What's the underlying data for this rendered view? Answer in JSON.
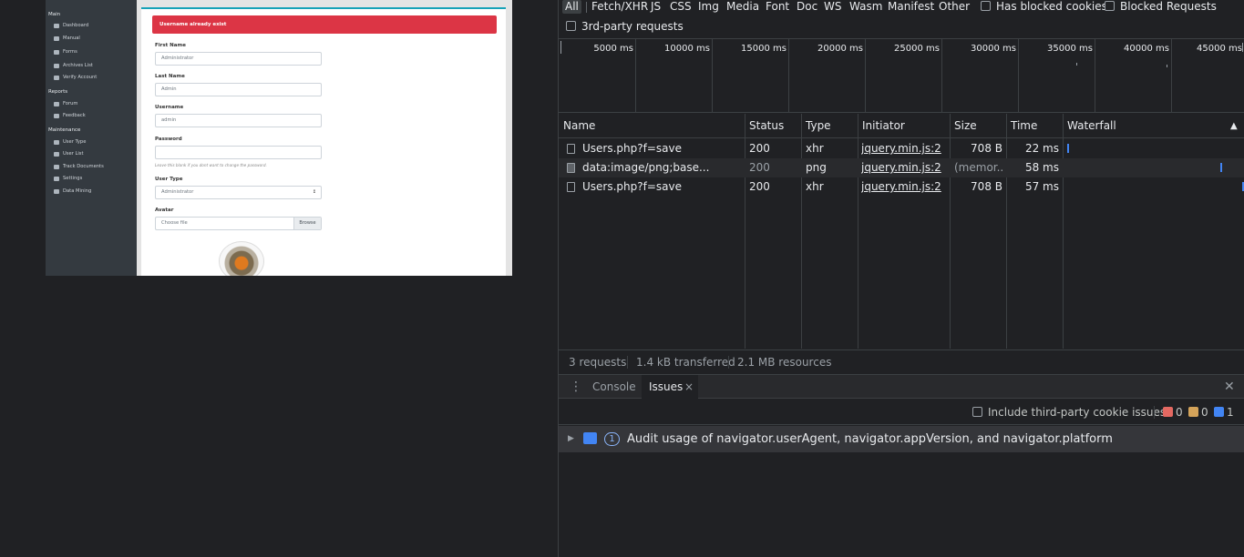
{
  "app": {
    "sidebar": {
      "main_header": "Main",
      "main_items": [
        "Dashboard",
        "Manual",
        "Forms",
        "Archives List",
        "Verify Account"
      ],
      "reports_header": "Reports",
      "reports_items": [
        "Forum",
        "Feedback"
      ],
      "maintenance_header": "Maintenance",
      "maintenance_items": [
        "User Type",
        "User List",
        "Track Documents",
        "Settings",
        "Data Mining"
      ]
    },
    "alert": "Username already exist",
    "form": {
      "first_name_label": "First Name",
      "first_name_value": "Administrator",
      "last_name_label": "Last Name",
      "last_name_value": "Admin",
      "username_label": "Username",
      "username_value": "admin",
      "password_label": "Password",
      "password_value": "",
      "password_hint": "Leave this blank if you dont want to change the password.",
      "user_type_label": "User Type",
      "user_type_value": "Administrator",
      "avatar_label": "Avatar",
      "avatar_placeholder": "Choose file",
      "browse_label": "Browse"
    }
  },
  "devtools": {
    "filters": [
      "All",
      "Fetch/XHR",
      "JS",
      "CSS",
      "Img",
      "Media",
      "Font",
      "Doc",
      "WS",
      "Wasm",
      "Manifest",
      "Other"
    ],
    "has_blocked_cookies": "Has blocked cookies",
    "blocked_requests": "Blocked Requests",
    "third_party": "3rd-party requests",
    "timeline_ticks": [
      "5000 ms",
      "10000 ms",
      "15000 ms",
      "20000 ms",
      "25000 ms",
      "30000 ms",
      "35000 ms",
      "40000 ms",
      "45000 ms"
    ],
    "columns": [
      "Name",
      "Status",
      "Type",
      "Initiator",
      "Size",
      "Time",
      "Waterfall"
    ],
    "rows": [
      {
        "name": "Users.php?f=save",
        "status": "200",
        "type": "xhr",
        "initiator": "jquery.min.js:2",
        "size": "708 B",
        "time": "22 ms"
      },
      {
        "name": "data:image/png;base...",
        "status": "200",
        "type": "png",
        "initiator": "jquery.min.js:2",
        "size": "(memor...",
        "time": "58 ms"
      },
      {
        "name": "Users.php?f=save",
        "status": "200",
        "type": "xhr",
        "initiator": "jquery.min.js:2",
        "size": "708 B",
        "time": "57 ms"
      }
    ],
    "summary": {
      "requests": "3 requests",
      "transferred": "1.4 kB transferred",
      "resources": "2.1 MB resources"
    },
    "drawer": {
      "more_icon": "⋮",
      "console_tab": "Console",
      "issues_tab": "Issues",
      "tab_close": "×",
      "drawer_close": "✕",
      "include_third_party": "Include third-party cookie issues",
      "error_count": "0",
      "warning_count": "0",
      "info_count": "1",
      "issue_count": "1",
      "issue_text": "Audit usage of navigator.userAgent, navigator.appVersion, and navigator.platform"
    }
  }
}
